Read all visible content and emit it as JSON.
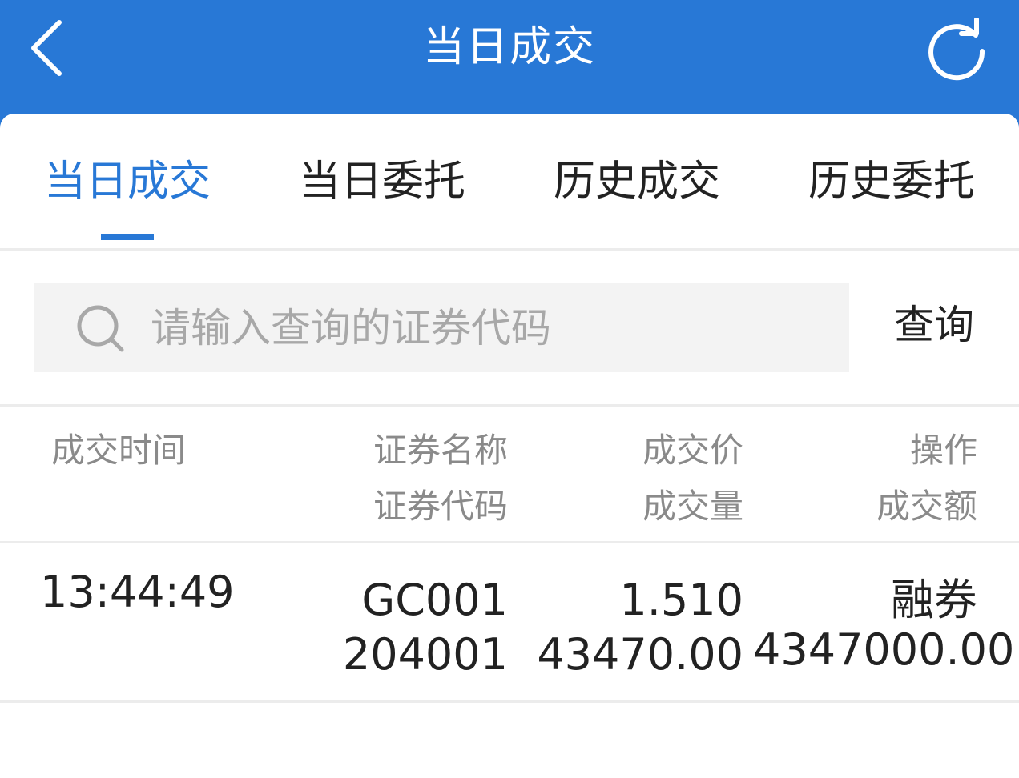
{
  "header": {
    "title": "当日成交",
    "back_icon": "chevron-left-icon",
    "refresh_icon": "refresh-icon"
  },
  "tabs": [
    {
      "label": "当日成交",
      "active": true
    },
    {
      "label": "当日委托",
      "active": false
    },
    {
      "label": "历史成交",
      "active": false
    },
    {
      "label": "历史委托",
      "active": false
    }
  ],
  "search": {
    "placeholder": "请输入查询的证券代码",
    "value": "",
    "icon": "search-icon",
    "button_label": "查询"
  },
  "columns": {
    "time": "成交时间",
    "name": "证券名称",
    "code": "证券代码",
    "price": "成交价",
    "volume": "成交量",
    "operation": "操作",
    "amount": "成交额"
  },
  "rows": [
    {
      "time": "13:44:49",
      "name": "GC001",
      "code": "204001",
      "price": "1.510",
      "volume": "43470.00",
      "operation": "融券",
      "amount": "4347000.00"
    }
  ],
  "colors": {
    "primary": "#2878d6",
    "text": "#222222",
    "muted": "#8a8a8a",
    "placeholder": "#a8a8a8",
    "divider": "#ececec"
  }
}
